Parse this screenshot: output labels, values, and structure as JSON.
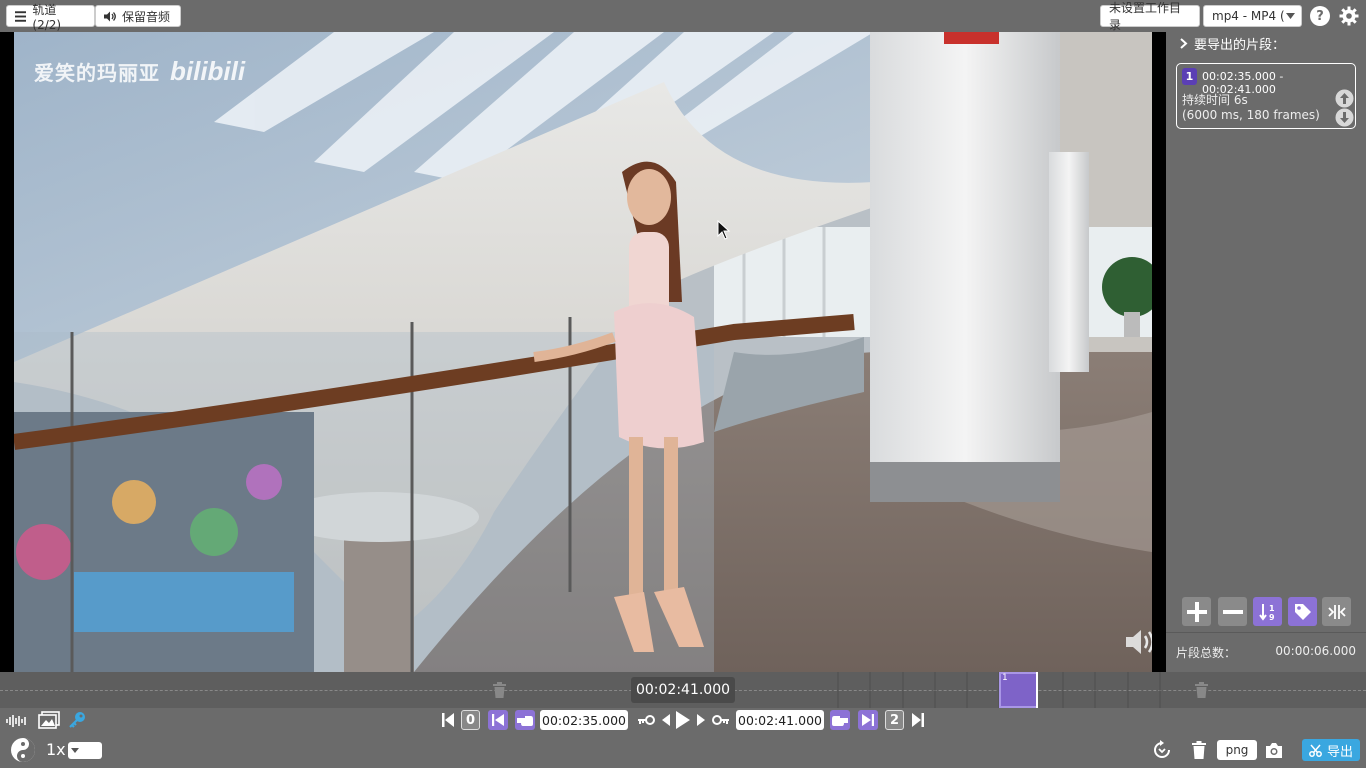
{
  "topbar": {
    "tracks_label": "轨道 (2/2)",
    "keep_audio_label": "保留音频",
    "workdir_label": "未设置工作目录",
    "format_label": "mp4 - MP4 (",
    "help_icon": "help-icon",
    "settings_icon": "gear-icon"
  },
  "video": {
    "watermark_text": "爱笑的玛丽亚",
    "watermark_logo": "bilibili",
    "volume_icon": "volume-icon"
  },
  "panel": {
    "title": "要导出的片段：",
    "segments": [
      {
        "index": "1",
        "range": "00:02:35.000 - 00:02:41.000",
        "duration": "持续时间 6s",
        "details": "(6000 ms, 180 frames)"
      }
    ],
    "total_label": "片段总数：",
    "total_value": "00:00:06.000",
    "buttons": [
      "plus-icon",
      "minus-icon",
      "sort-icon",
      "tag-icon",
      "split-icon"
    ]
  },
  "timeline": {
    "current_time": "00:02:41.000",
    "segment_label": "1"
  },
  "controls": {
    "start_segment_num": "0",
    "end_segment_num": "2",
    "cut_start": "00:02:35.000",
    "cut_end": "00:02:41.000",
    "speed": "1x",
    "screenshot_format": "png",
    "export_label": "导出"
  },
  "colors": {
    "accent": "#8c72d6",
    "export": "#3aa7e0",
    "background": "#6b6b6b"
  }
}
